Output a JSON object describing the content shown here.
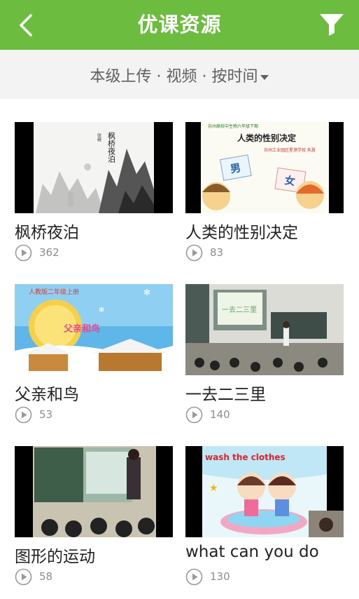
{
  "header": {
    "title": "优课资源"
  },
  "filterbar": {
    "label": "本级上传 · 视频 · 按时间"
  },
  "icons": {
    "back": "back-chevron-icon",
    "filter": "funnel-icon",
    "play": "play-circle-icon",
    "dropdown": "caret-down-icon"
  },
  "colors": {
    "brand": "#6cbc3f",
    "filterbar_bg": "#f3f3f3"
  },
  "thumb_text": {
    "t1": [
      "枫桥夜泊",
      "张继"
    ],
    "t2": [
      "苏州高校中生物六年级下期",
      "人类的性别决定",
      "苏州工业园区星港学校 朱慧",
      "男",
      "女"
    ],
    "t3": [
      "人教版二年级上册",
      "父亲和鸟"
    ],
    "t4": [
      "一去二三里"
    ],
    "t6": [
      "wash the clothes"
    ]
  },
  "videos": [
    {
      "title": "枫桥夜泊",
      "views": "362"
    },
    {
      "title": "人类的性别决定",
      "views": "83"
    },
    {
      "title": "父亲和鸟",
      "views": "53"
    },
    {
      "title": "一去二三里",
      "views": "140"
    },
    {
      "title": "图形的运动",
      "views": "58"
    },
    {
      "title": "what can you do",
      "views": "130"
    }
  ]
}
